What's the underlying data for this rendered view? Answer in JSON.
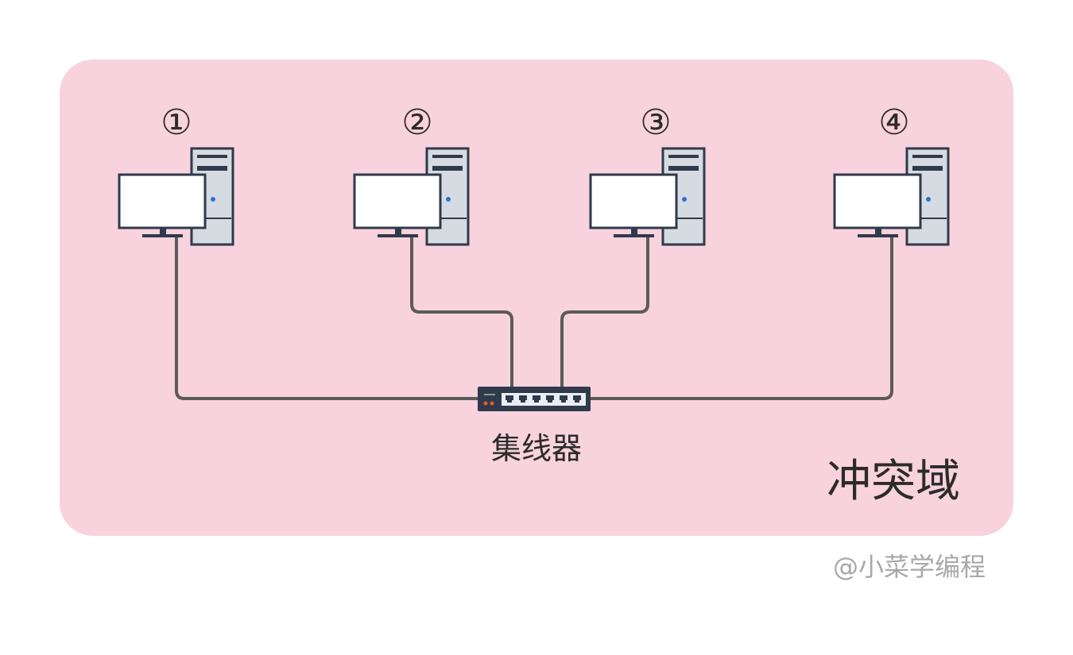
{
  "colors": {
    "page_background": "#ffffff",
    "domain_fill": "#f8d2dd",
    "cable": "#5b5b5b",
    "monitor_screen": "#ffffff",
    "monitor_frame": "#2f3a4b",
    "tower_body": "#d5dbe0",
    "tower_outline": "#2f3a4b",
    "power_led": "#2f6fd6",
    "hub_body": "#2f3a4b",
    "hub_ports": "#e9eef3",
    "hub_leds": "#e0622b",
    "text": "#2b2b2b",
    "watermark": "#a8a8a8"
  },
  "computers": [
    {
      "label": "①",
      "icon": "desktop-computer-icon"
    },
    {
      "label": "②",
      "icon": "desktop-computer-icon"
    },
    {
      "label": "③",
      "icon": "desktop-computer-icon"
    },
    {
      "label": "④",
      "icon": "desktop-computer-icon"
    }
  ],
  "hub": {
    "label": "集线器",
    "icon": "network-hub-icon"
  },
  "collision_domain": {
    "label": "冲突域"
  },
  "watermark": "@小菜学编程"
}
